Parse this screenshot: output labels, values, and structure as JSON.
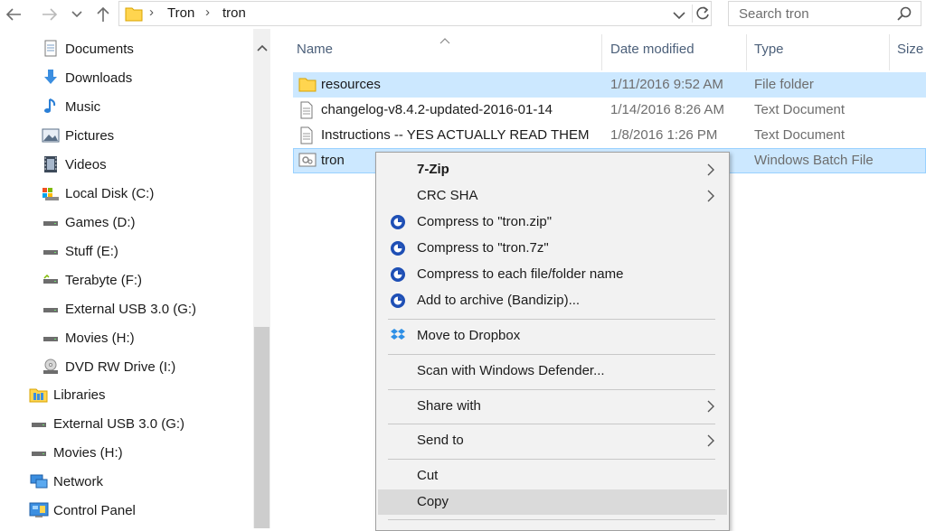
{
  "address_bar": {
    "breadcrumbs": [
      "Tron",
      "tron"
    ],
    "search_placeholder": "Search tron"
  },
  "nav_pane": {
    "items": [
      {
        "label": "Documents",
        "icon": "documents-icon"
      },
      {
        "label": "Downloads",
        "icon": "downloads-icon"
      },
      {
        "label": "Music",
        "icon": "music-icon"
      },
      {
        "label": "Pictures",
        "icon": "pictures-icon"
      },
      {
        "label": "Videos",
        "icon": "videos-icon"
      },
      {
        "label": "Local Disk (C:)",
        "icon": "local-disk-icon"
      },
      {
        "label": "Games (D:)",
        "icon": "drive-icon"
      },
      {
        "label": "Stuff (E:)",
        "icon": "drive-icon"
      },
      {
        "label": "Terabyte (F:)",
        "icon": "drive-icon"
      },
      {
        "label": "External USB 3.0 (G:)",
        "icon": "drive-icon"
      },
      {
        "label": "Movies (H:)",
        "icon": "drive-icon"
      },
      {
        "label": "DVD RW Drive (I:)",
        "icon": "dvd-drive-icon"
      },
      {
        "label": "Libraries",
        "icon": "libraries-icon"
      },
      {
        "label": "External USB 3.0 (G:)",
        "icon": "drive-icon"
      },
      {
        "label": "Movies (H:)",
        "icon": "drive-icon"
      },
      {
        "label": "Network",
        "icon": "network-icon"
      },
      {
        "label": "Control Panel",
        "icon": "control-panel-icon"
      }
    ]
  },
  "file_list": {
    "columns": [
      "Name",
      "Date modified",
      "Type",
      "Size"
    ],
    "rows": [
      {
        "name": "resources",
        "date": "1/11/2016 9:52 AM",
        "type": "File folder",
        "icon": "folder-icon",
        "selected": true
      },
      {
        "name": "changelog-v8.4.2-updated-2016-01-14",
        "date": "1/14/2016 8:26 AM",
        "type": "Text Document",
        "icon": "text-document-icon",
        "selected": false
      },
      {
        "name": "Instructions -- YES ACTUALLY READ THEM",
        "date": "1/8/2016 1:26 PM",
        "type": "Text Document",
        "icon": "text-document-icon",
        "selected": false
      },
      {
        "name": "tron",
        "date": "",
        "type": "Windows Batch File",
        "icon": "batch-file-icon",
        "selected": true
      }
    ]
  },
  "context_menu": {
    "items": [
      {
        "label": "7-Zip",
        "bold": true,
        "submenu": true
      },
      {
        "label": "CRC SHA",
        "submenu": true
      },
      {
        "label": "Compress to \"tron.zip\"",
        "icon": "bandizip-icon"
      },
      {
        "label": "Compress to \"tron.7z\"",
        "icon": "bandizip-icon"
      },
      {
        "label": "Compress to each file/folder name",
        "icon": "bandizip-icon"
      },
      {
        "label": "Add to archive (Bandizip)...",
        "icon": "bandizip-icon"
      },
      {
        "label": "Move to Dropbox",
        "icon": "dropbox-icon"
      },
      {
        "label": "Scan with Windows Defender..."
      },
      {
        "label": "Share with",
        "submenu": true
      },
      {
        "label": "Send to",
        "submenu": true
      },
      {
        "label": "Cut"
      },
      {
        "label": "Copy",
        "hover": true
      }
    ]
  },
  "colors": {
    "selection": "#cce8ff",
    "menu_background": "#f2f2f2",
    "menu_hover": "#dadada",
    "column_header_text": "#4c607a"
  }
}
